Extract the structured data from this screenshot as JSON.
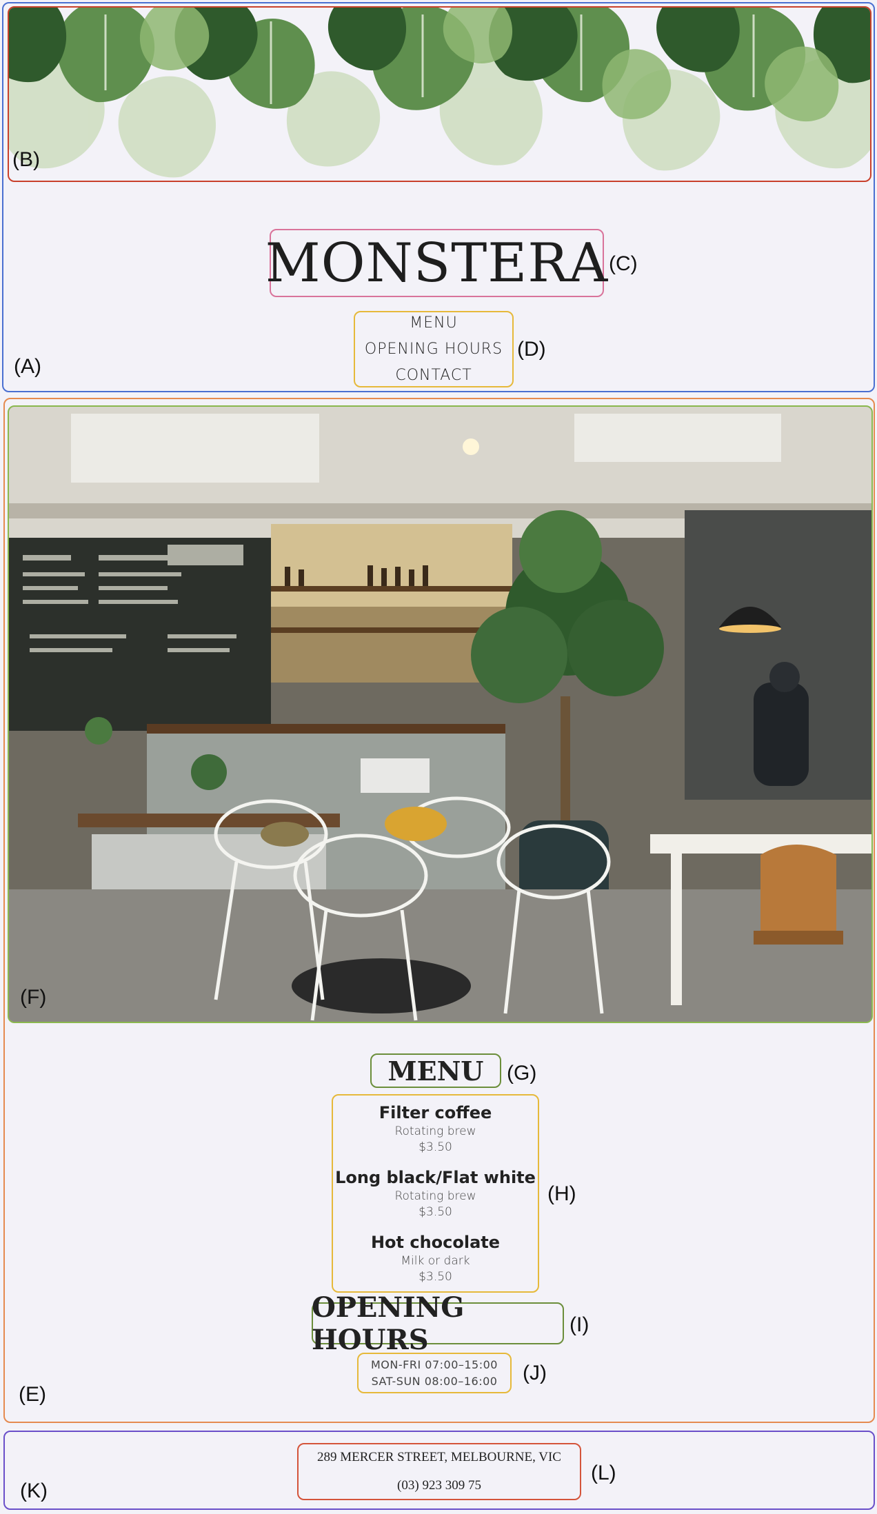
{
  "header": {
    "title": "MONSTERA",
    "nav": [
      {
        "label": "MENU"
      },
      {
        "label": "OPENING HOURS"
      },
      {
        "label": "CONTACT"
      }
    ]
  },
  "menu": {
    "heading": "MENU",
    "items": [
      {
        "name": "Filter coffee",
        "desc": "Rotating brew",
        "price": "$3.50"
      },
      {
        "name": "Long black/Flat white",
        "desc": "Rotating brew",
        "price": "$3.50"
      },
      {
        "name": "Hot chocolate",
        "desc": "Milk or dark",
        "price": "$3.50"
      }
    ]
  },
  "hours": {
    "heading": "OPENING HOURS",
    "lines": [
      "MON-FRI 07:00–15:00",
      "SAT-SUN 08:00–16:00"
    ]
  },
  "footer": {
    "address": "289 MERCER STREET, MELBOURNE, VIC",
    "phone": "(03) 923 309 75"
  },
  "annotations": [
    "(A)",
    "(B)",
    "(C)",
    "(D)",
    "(E)",
    "(F)",
    "(G)",
    "(H)",
    "(I)",
    "(J)",
    "(K)",
    "(L)"
  ],
  "colors": {
    "background": "#f3f2f8",
    "leaf_dark": "#3f6b3a",
    "leaf_light": "#a9c78c"
  }
}
